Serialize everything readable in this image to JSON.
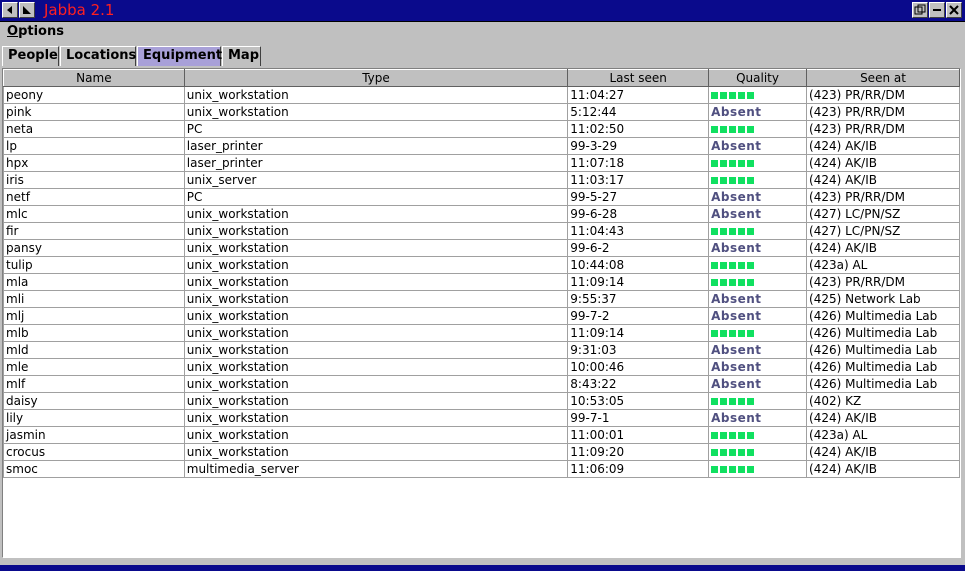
{
  "window": {
    "title": "Jabba 2.1",
    "colors": {
      "titlebar": "#0a0a8c",
      "title_text": "#ff2020",
      "active_tab": "#a8a0d8",
      "quality_good": "#10e060",
      "absent_text": "#505080"
    }
  },
  "menu": {
    "options_label": "Options"
  },
  "tabs": [
    {
      "label": "People"
    },
    {
      "label": "Locations"
    },
    {
      "label": "Equipment",
      "active": true
    },
    {
      "label": "Map"
    }
  ],
  "table": {
    "columns": [
      "Name",
      "Type",
      "Last seen",
      "Quality",
      "Seen at"
    ],
    "absent_label": "Absent",
    "rows": [
      {
        "name": "peony",
        "type": "unix_workstation",
        "last_seen": "11:04:27",
        "quality": "good",
        "seen_at": "(423) PR/RR/DM"
      },
      {
        "name": "pink",
        "type": "unix_workstation",
        "last_seen": "5:12:44",
        "quality": "absent",
        "seen_at": "(423) PR/RR/DM"
      },
      {
        "name": "neta",
        "type": "PC",
        "last_seen": "11:02:50",
        "quality": "good",
        "seen_at": "(423) PR/RR/DM"
      },
      {
        "name": "lp",
        "type": "laser_printer",
        "last_seen": "99-3-29",
        "quality": "absent",
        "seen_at": "(424) AK/IB"
      },
      {
        "name": "hpx",
        "type": "laser_printer",
        "last_seen": "11:07:18",
        "quality": "good",
        "seen_at": "(424) AK/IB"
      },
      {
        "name": "iris",
        "type": "unix_server",
        "last_seen": "11:03:17",
        "quality": "good",
        "seen_at": "(424) AK/IB"
      },
      {
        "name": "netf",
        "type": "PC",
        "last_seen": "99-5-27",
        "quality": "absent",
        "seen_at": "(423) PR/RR/DM"
      },
      {
        "name": "mlc",
        "type": "unix_workstation",
        "last_seen": "99-6-28",
        "quality": "absent",
        "seen_at": "(427) LC/PN/SZ"
      },
      {
        "name": "fir",
        "type": "unix_workstation",
        "last_seen": "11:04:43",
        "quality": "good",
        "seen_at": "(427) LC/PN/SZ"
      },
      {
        "name": "pansy",
        "type": "unix_workstation",
        "last_seen": "99-6-2",
        "quality": "absent",
        "seen_at": "(424) AK/IB"
      },
      {
        "name": "tulip",
        "type": "unix_workstation",
        "last_seen": "10:44:08",
        "quality": "good",
        "seen_at": "(423a) AL"
      },
      {
        "name": "mla",
        "type": "unix_workstation",
        "last_seen": "11:09:14",
        "quality": "good",
        "seen_at": "(423) PR/RR/DM"
      },
      {
        "name": "mli",
        "type": "unix_workstation",
        "last_seen": "9:55:37",
        "quality": "absent",
        "seen_at": "(425) Network Lab"
      },
      {
        "name": "mlj",
        "type": "unix_workstation",
        "last_seen": "99-7-2",
        "quality": "absent",
        "seen_at": "(426) Multimedia Lab"
      },
      {
        "name": "mlb",
        "type": "unix_workstation",
        "last_seen": "11:09:14",
        "quality": "good",
        "seen_at": "(426) Multimedia Lab"
      },
      {
        "name": "mld",
        "type": "unix_workstation",
        "last_seen": "9:31:03",
        "quality": "absent",
        "seen_at": "(426) Multimedia Lab"
      },
      {
        "name": "mle",
        "type": "unix_workstation",
        "last_seen": "10:00:46",
        "quality": "absent",
        "seen_at": "(426) Multimedia Lab"
      },
      {
        "name": "mlf",
        "type": "unix_workstation",
        "last_seen": "8:43:22",
        "quality": "absent",
        "seen_at": "(426) Multimedia Lab"
      },
      {
        "name": "daisy",
        "type": "unix_workstation",
        "last_seen": "10:53:05",
        "quality": "good",
        "seen_at": "(402) KZ"
      },
      {
        "name": "lily",
        "type": "unix_workstation",
        "last_seen": "99-7-1",
        "quality": "absent",
        "seen_at": "(424) AK/IB"
      },
      {
        "name": "jasmin",
        "type": "unix_workstation",
        "last_seen": "11:00:01",
        "quality": "good",
        "seen_at": "(423a) AL"
      },
      {
        "name": "crocus",
        "type": "unix_workstation",
        "last_seen": "11:09:20",
        "quality": "good",
        "seen_at": "(424) AK/IB"
      },
      {
        "name": "smoc",
        "type": "multimedia_server",
        "last_seen": "11:06:09",
        "quality": "good",
        "seen_at": "(424) AK/IB"
      }
    ]
  }
}
